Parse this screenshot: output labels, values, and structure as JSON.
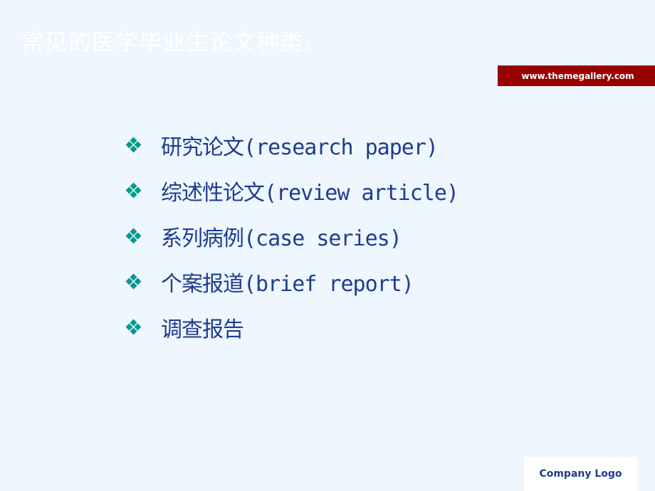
{
  "slide": {
    "title": "常见的医学毕业生论文种类:",
    "url_banner": "www.themegallery.com",
    "bullets": [
      {
        "icon": "diamond-cluster-icon",
        "text": "研究论文(research paper)"
      },
      {
        "icon": "diamond-cluster-icon",
        "text": "综述性论文(review article)"
      },
      {
        "icon": "diamond-cluster-icon",
        "text": "系列病例(case series)"
      },
      {
        "icon": "diamond-cluster-icon",
        "text": "个案报道(brief report)"
      },
      {
        "icon": "diamond-cluster-icon",
        "text": "调查报告"
      }
    ],
    "logo_text": "Company Logo"
  },
  "colors": {
    "background": "#eef6fe",
    "title": "#ffffff",
    "banner": "#990000",
    "body_text": "#1f3c8e",
    "bullet": "#009a8e"
  }
}
